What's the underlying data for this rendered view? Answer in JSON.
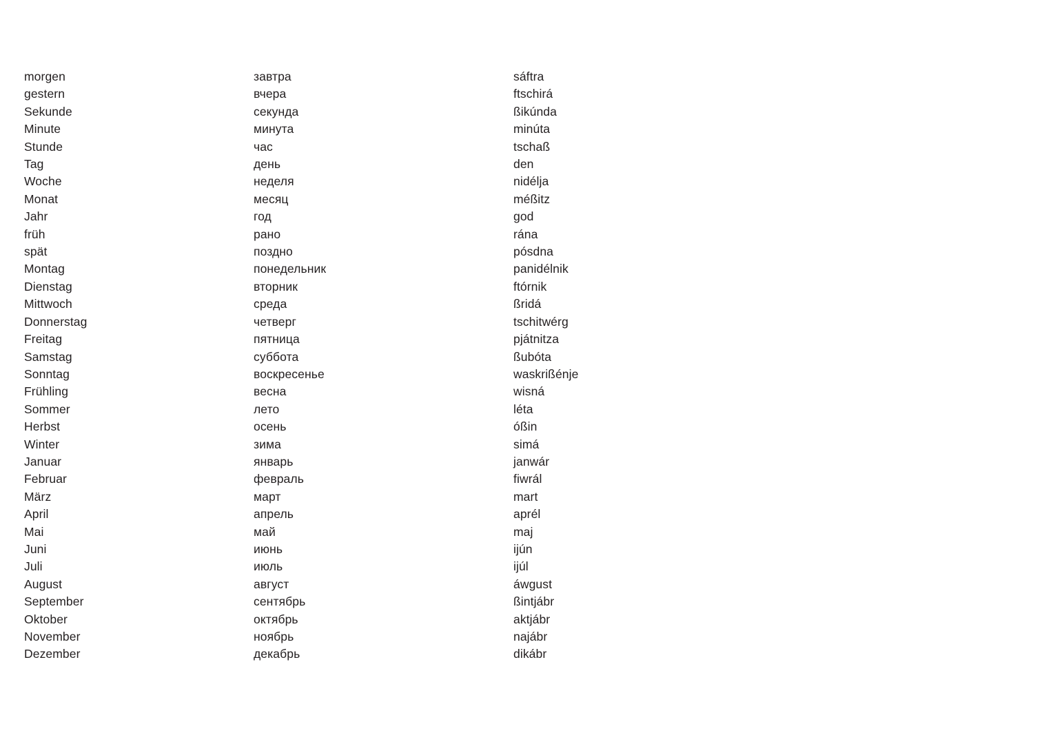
{
  "document": {
    "type": "vocabulary-list",
    "columns": [
      "german",
      "russian",
      "transliteration"
    ],
    "text_color": "#231f20",
    "background_color": "#ffffff"
  },
  "rows": [
    {
      "german": "morgen",
      "russian": "завтра",
      "transliteration": "sáftra"
    },
    {
      "german": "gestern",
      "russian": "вчера",
      "transliteration": "ftschirá"
    },
    {
      "german": "Sekunde",
      "russian": "секунда",
      "transliteration": "ßikúnda"
    },
    {
      "german": "Minute",
      "russian": "минута",
      "transliteration": "minúta"
    },
    {
      "german": "Stunde",
      "russian": "час",
      "transliteration": "tschaß"
    },
    {
      "german": "Tag",
      "russian": "день",
      "transliteration": "den"
    },
    {
      "german": "Woche",
      "russian": "неделя",
      "transliteration": "nidélja"
    },
    {
      "german": "Monat",
      "russian": "месяц",
      "transliteration": "méßitz"
    },
    {
      "german": "Jahr",
      "russian": "год",
      "transliteration": "god"
    },
    {
      "german": "früh",
      "russian": "рано",
      "transliteration": "rána"
    },
    {
      "german": "spät",
      "russian": "поздно",
      "transliteration": "pósdna"
    },
    {
      "german": "Montag",
      "russian": "понедельник",
      "transliteration": "panidélnik"
    },
    {
      "german": "Dienstag",
      "russian": "вторник",
      "transliteration": "ftórnik"
    },
    {
      "german": "Mittwoch",
      "russian": "среда",
      "transliteration": "ßridá"
    },
    {
      "german": "Donnerstag",
      "russian": "четверг",
      "transliteration": "tschitwérg"
    },
    {
      "german": "Freitag",
      "russian": "пятница",
      "transliteration": "pjátnitza"
    },
    {
      "german": "Samstag",
      "russian": "суббота",
      "transliteration": "ßubóta"
    },
    {
      "german": "Sonntag",
      "russian": "воскресенье",
      "transliteration": "waskrißénje"
    },
    {
      "german": "Frühling",
      "russian": "весна",
      "transliteration": "wisná"
    },
    {
      "german": "Sommer",
      "russian": "лето",
      "transliteration": "léta"
    },
    {
      "german": "Herbst",
      "russian": "осень",
      "transliteration": "óßin"
    },
    {
      "german": "Winter",
      "russian": "зима",
      "transliteration": "simá"
    },
    {
      "german": "Januar",
      "russian": "январь",
      "transliteration": "janwár"
    },
    {
      "german": "Februar",
      "russian": "февраль",
      "transliteration": "fiwrál"
    },
    {
      "german": "März",
      "russian": "март",
      "transliteration": "mart"
    },
    {
      "german": "April",
      "russian": "апрель",
      "transliteration": "aprél"
    },
    {
      "german": "Mai",
      "russian": "май",
      "transliteration": "maj"
    },
    {
      "german": "Juni",
      "russian": "июнь",
      "transliteration": "ijún"
    },
    {
      "german": "Juli",
      "russian": "июль",
      "transliteration": "ijúl"
    },
    {
      "german": "August",
      "russian": "август",
      "transliteration": "áwgust"
    },
    {
      "german": "September",
      "russian": "сентябрь",
      "transliteration": "ßintjábr"
    },
    {
      "german": "Oktober",
      "russian": "октябрь",
      "transliteration": "aktjábr"
    },
    {
      "german": "November",
      "russian": "ноябрь",
      "transliteration": "najábr"
    },
    {
      "german": "Dezember",
      "russian": "декабрь",
      "transliteration": "dikábr"
    }
  ]
}
